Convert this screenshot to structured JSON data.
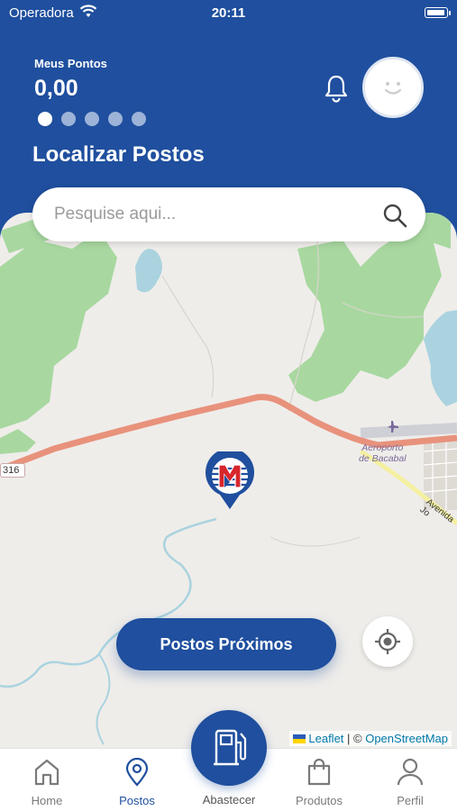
{
  "status_bar": {
    "carrier": "Operadora",
    "time": "20:11"
  },
  "header": {
    "points_label": "Meus Pontos",
    "points_value": "0,00",
    "page_title": "Localizar Postos",
    "carousel_dots": 5,
    "active_dot": 0
  },
  "search": {
    "placeholder": "Pesquise aqui...",
    "value": ""
  },
  "map": {
    "airport_label_1": "Aeroporto",
    "airport_label_2": "de Bacabal",
    "road_shield": "316",
    "street_label": "Avenida Jo",
    "attribution_leaflet": "Leaflet",
    "attribution_sep": " | © ",
    "attribution_osm": "OpenStreetMap"
  },
  "actions": {
    "nearby_button": "Postos Próximos"
  },
  "tabs": [
    {
      "label": "Home",
      "icon": "home-icon",
      "active": false
    },
    {
      "label": "Postos",
      "icon": "map-pin-icon",
      "active": true
    },
    {
      "label": "Abastecer",
      "icon": "fuel-pump-icon",
      "active": false
    },
    {
      "label": "Produtos",
      "icon": "shopping-bag-icon",
      "active": false
    },
    {
      "label": "Perfil",
      "icon": "user-icon",
      "active": false
    }
  ],
  "colors": {
    "primary": "#1f4f9e",
    "tab_inactive": "#7a7a7a",
    "map_bg": "#efedea",
    "forest": "#a8d8a0",
    "water": "#aad3df",
    "highway": "#e8927c"
  }
}
